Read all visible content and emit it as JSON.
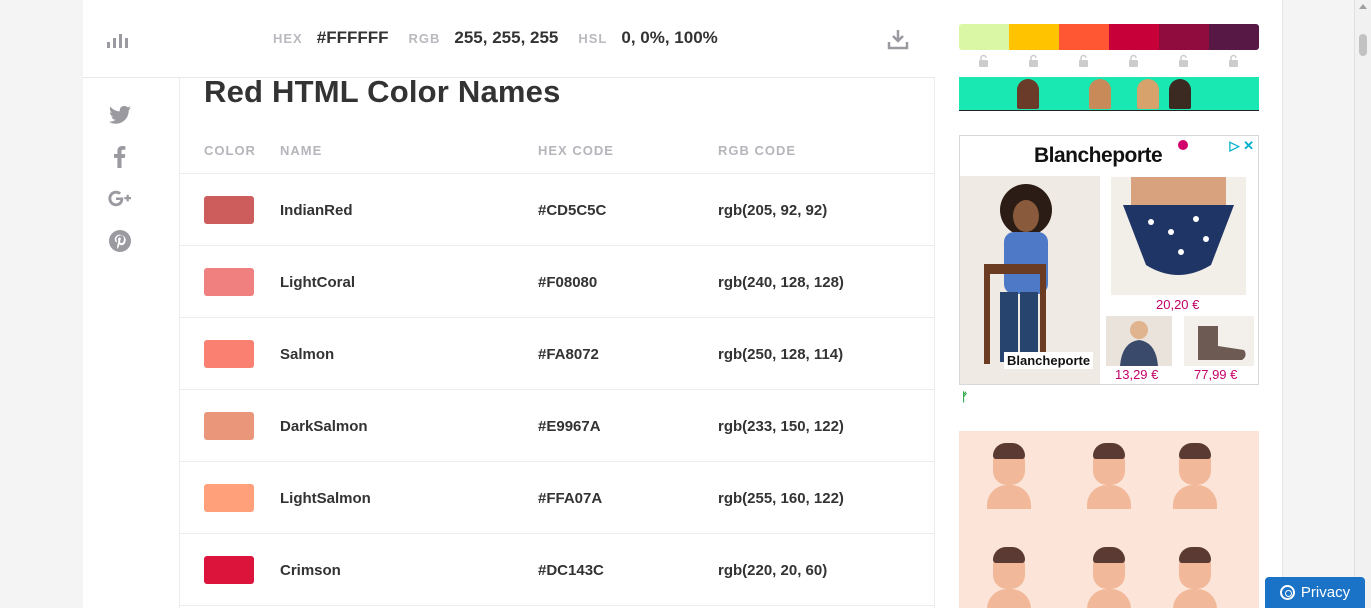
{
  "colorbar": {
    "hex_label": "HEX",
    "hex_value": "#FFFFFF",
    "rgb_label": "RGB",
    "rgb_value": "255, 255, 255",
    "hsl_label": "HSL",
    "hsl_value": "0, 0%, 100%"
  },
  "page": {
    "title": "Red HTML Color Names"
  },
  "table": {
    "headers": {
      "color": "COLOR",
      "name": "NAME",
      "hex": "HEX CODE",
      "rgb": "RGB CODE"
    },
    "rows": [
      {
        "name": "IndianRed",
        "hex": "#CD5C5C",
        "rgb": "rgb(205, 92, 92)",
        "swatch": "#CD5C5C"
      },
      {
        "name": "LightCoral",
        "hex": "#F08080",
        "rgb": "rgb(240, 128, 128)",
        "swatch": "#F08080"
      },
      {
        "name": "Salmon",
        "hex": "#FA8072",
        "rgb": "rgb(250, 128, 114)",
        "swatch": "#FA8072"
      },
      {
        "name": "DarkSalmon",
        "hex": "#E9967A",
        "rgb": "rgb(233, 150, 122)",
        "swatch": "#E9967A"
      },
      {
        "name": "LightSalmon",
        "hex": "#FFA07A",
        "rgb": "rgb(255, 160, 122)",
        "swatch": "#FFA07A"
      },
      {
        "name": "Crimson",
        "hex": "#DC143C",
        "rgb": "rgb(220, 20, 60)",
        "swatch": "#DC143C"
      }
    ]
  },
  "palette": [
    "#DAF7A6",
    "#FFC300",
    "#FF5733",
    "#C70039",
    "#900C3F",
    "#581845"
  ],
  "icons": {
    "twitter": "twitter-icon",
    "facebook": "facebook-icon",
    "google_plus": "google-plus-icon",
    "pinterest": "pinterest-icon",
    "download": "download-icon",
    "bars": "bars-chart-icon"
  },
  "ad": {
    "brand": "Blancheporte",
    "brand_label": "Blancheporte",
    "price_1": "20,20 €",
    "price_2": "13,29 €",
    "price_3": "77,99 €",
    "choices": "▷ ✕"
  },
  "privacy": {
    "label": "Privacy"
  }
}
